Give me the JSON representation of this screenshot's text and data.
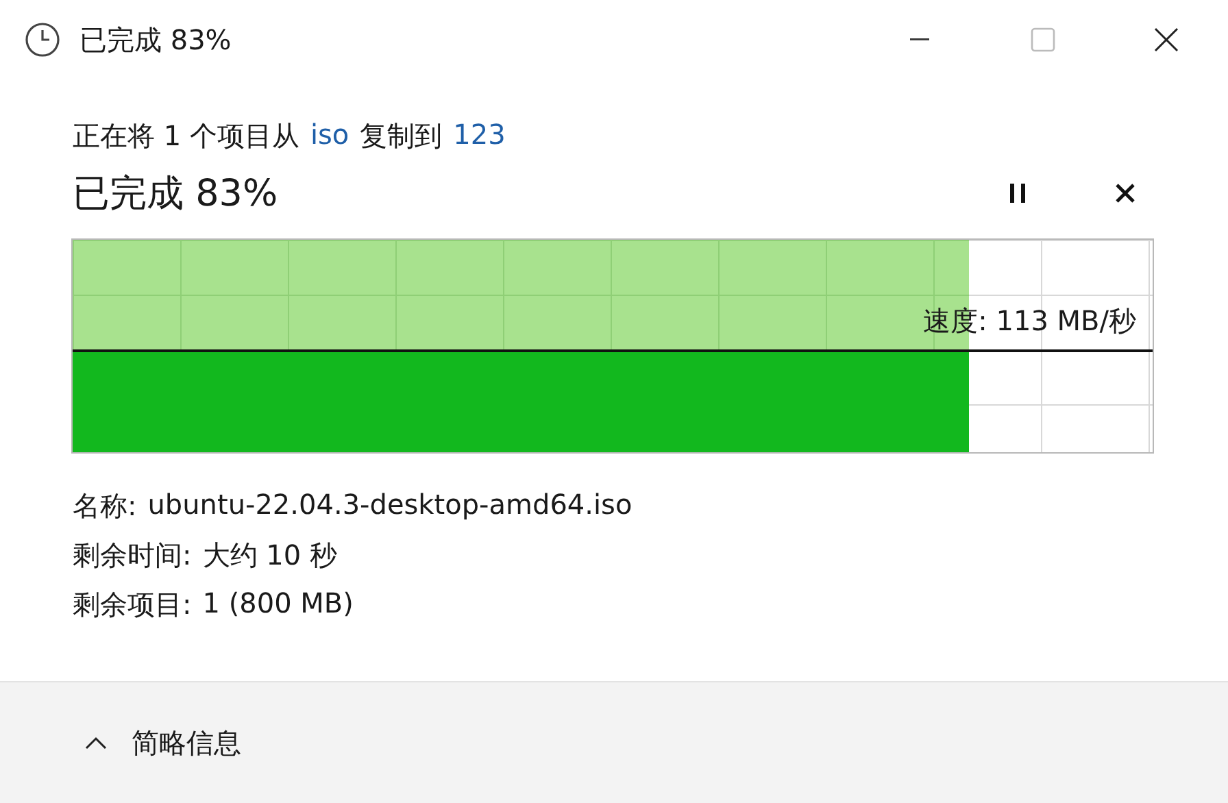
{
  "window": {
    "title": "已完成 83%",
    "maximize_disabled": true
  },
  "copy_line": {
    "prefix": "正在将 1 个项目从",
    "source": "iso",
    "middle": "复制到",
    "destination": "123"
  },
  "heading": "已完成 83%",
  "progress": {
    "speed": "速度: 113 MB/秒"
  },
  "details": [
    {
      "label": "名称:",
      "value": "ubuntu-22.04.3-desktop-amd64.iso"
    },
    {
      "label": "剩余时间:",
      "value": "大约 10 秒"
    },
    {
      "label": "剩余项目:",
      "value": "1 (800 MB)"
    }
  ],
  "footer": {
    "toggle": "简略信息",
    "expanded": true
  }
}
